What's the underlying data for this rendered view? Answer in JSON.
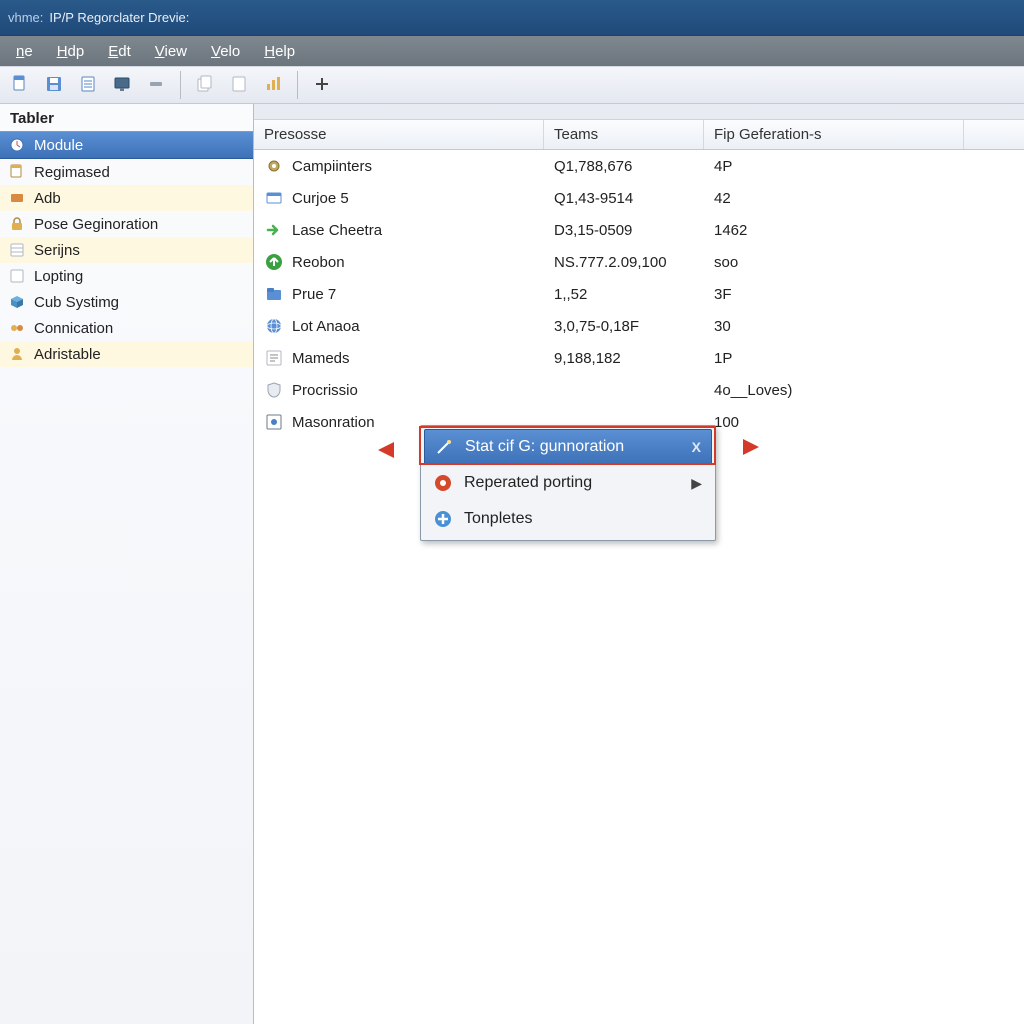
{
  "title": {
    "prefix": "vhme:",
    "text": "IP/P Regorclater Drevie:"
  },
  "menu": {
    "items": [
      {
        "label": "ne",
        "accel": "n"
      },
      {
        "label": "Hdp",
        "accel": "H"
      },
      {
        "label": "Edt",
        "accel": "E"
      },
      {
        "label": "View",
        "accel": "V"
      },
      {
        "label": "Velo",
        "accel": "V"
      },
      {
        "label": "Help",
        "accel": "H"
      }
    ]
  },
  "toolbar": {
    "buttons": [
      {
        "name": "doc-icon"
      },
      {
        "name": "save-icon"
      },
      {
        "name": "page-icon"
      },
      {
        "name": "monitor-icon"
      },
      {
        "name": "minus-icon"
      },
      {
        "sep": true
      },
      {
        "name": "copy-icon"
      },
      {
        "name": "page2-icon"
      },
      {
        "name": "chart-icon"
      },
      {
        "sep": true
      },
      {
        "name": "plus-add-icon"
      }
    ]
  },
  "sidebar": {
    "title": "Tabler",
    "items": [
      {
        "label": "Module",
        "icon": "clock-icon",
        "state": "selected"
      },
      {
        "label": "Regimased",
        "icon": "page-icon"
      },
      {
        "label": "Adb",
        "icon": "brick-icon",
        "state": "highlighted"
      },
      {
        "label": "Pose Geginoration",
        "icon": "lock-icon"
      },
      {
        "label": "Serijns",
        "icon": "sheet-icon",
        "state": "highlighted"
      },
      {
        "label": "Lopting",
        "icon": "sheet2-icon"
      },
      {
        "label": "Cub Systimg",
        "icon": "cube-icon"
      },
      {
        "label": "Connication",
        "icon": "connect-icon"
      },
      {
        "label": "Adristable",
        "icon": "user-icon",
        "state": "highlighted"
      }
    ]
  },
  "table": {
    "headers": {
      "presosse": "Presosse",
      "teams": "Teams",
      "fip": "Fip Geferation-s"
    },
    "rows": [
      {
        "icon": "gear-icon",
        "presosse": "Campiinters",
        "teams": "Q1,788,676",
        "fip": "4P"
      },
      {
        "icon": "card-icon",
        "presosse": "Curjoe 5",
        "teams": "Q1,43-9514",
        "fip": "42"
      },
      {
        "icon": "arrow-right-icon",
        "presosse": "Lase Cheetra",
        "teams": "D3,15-0509",
        "fip": "1462"
      },
      {
        "icon": "arrow-up-icon",
        "presosse": "Reobon",
        "teams": "NS.777.2.09,100",
        "fip": "soo"
      },
      {
        "icon": "folder-icon",
        "presosse": "Prue 7",
        "teams": "1,,52",
        "fip": "3F"
      },
      {
        "icon": "globe-icon",
        "presosse": "Lot Anaoa",
        "teams": "3,0,75-0,18F",
        "fip": "30"
      },
      {
        "icon": "text-icon",
        "presosse": "Mameds",
        "teams": "9,188,182",
        "fip": "1P"
      },
      {
        "icon": "shield-icon",
        "presosse": "Procrissio",
        "teams": "",
        "fip": "4o__Loves)"
      },
      {
        "icon": "frame-icon",
        "presosse": "Masonration",
        "teams": "",
        "fip": "100"
      }
    ]
  },
  "context_menu": {
    "items": [
      {
        "label": "Stat cif G: gunnoration",
        "icon": "wand-icon",
        "selected": true,
        "close": "X"
      },
      {
        "label": "Reperated porting",
        "icon": "red-circle-icon",
        "submenu": true
      },
      {
        "label": "Tonpletes",
        "icon": "plus-circle-icon"
      }
    ]
  }
}
